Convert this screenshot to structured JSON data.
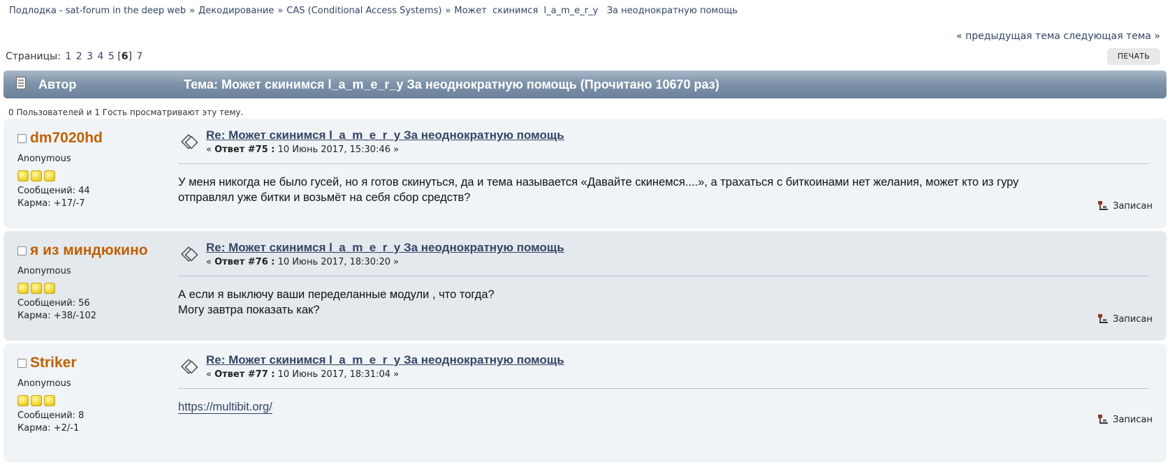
{
  "breadcrumb": {
    "items": [
      "Подлодка - sat-forum in the deep web",
      "Декодирование",
      "CAS (Conditional Access Systems)",
      "Может  скинимся  l_a_m_e_r_y   За неоднократную помощь"
    ],
    "separator": "»"
  },
  "topic_nav": {
    "prev": "« предыдущая тема",
    "next": "следующая тема »"
  },
  "pagination": {
    "label": "Страницы:",
    "pages": [
      "1",
      "2",
      "3",
      "4",
      "5"
    ],
    "current": "6",
    "after": [
      "7"
    ]
  },
  "print_button": "ПЕЧАТЬ",
  "header": {
    "author": "Автор",
    "topic": "Тема: Может скинимся l_a_m_e_r_y За неоднократную помощь  (Прочитано 10670 раз)"
  },
  "viewers": "0 Пользователей и 1 Гость просматривают эту тему.",
  "posts": [
    {
      "author": "dm7020hd",
      "group": "Anonymous",
      "messages": "Сообщений: 44",
      "karma": "Карма: +17/-7",
      "title": "Re: Может скинимся l_a_m_e_r_y За неоднократную помощь",
      "meta_prefix": "« ",
      "reply": "Ответ #75 :",
      "date": " 10 Июнь 2017, 15:30:46 »",
      "lines": [
        "У меня никогда не было гусей, но я готов скинуться, да и тема называется «Давайте скинемся....», а трахаться с биткоинами нет желания, может кто из гуру",
        "отправлял уже битки и возьмёт на себя сбор средств?"
      ],
      "saved": "Записан"
    },
    {
      "author": "я из миндюкино",
      "group": "Anonymous",
      "messages": "Сообщений: 56",
      "karma": "Карма: +38/-102",
      "title": "Re: Может скинимся l_a_m_e_r_y За неоднократную помощь",
      "meta_prefix": "« ",
      "reply": "Ответ #76 :",
      "date": " 10 Июнь 2017, 18:30:20 »",
      "lines": [
        "А если я выключу ваши переделанные модули , что тогда?",
        "Могу завтра показать как?"
      ],
      "saved": "Записан"
    },
    {
      "author": "Striker",
      "group": "Anonymous",
      "messages": "Сообщений: 8",
      "karma": "Карма: +2/-1",
      "title": "Re: Может скинимся l_a_m_e_r_y За неоднократную помощь",
      "meta_prefix": "« ",
      "reply": "Ответ #77 :",
      "date": " 10 Июнь 2017, 18:31:04 »",
      "link": "https://multibit.org/",
      "saved": "Записан"
    }
  ],
  "icons": {
    "topic": "document-icon",
    "post": "post-xx-icon",
    "saved": "ip-logged-icon",
    "online": "offline-status-icon",
    "rank": "rank-star-icon"
  },
  "colors": {
    "author": "#c06002",
    "link": "#334466",
    "header_bar": "#7f94aa"
  }
}
